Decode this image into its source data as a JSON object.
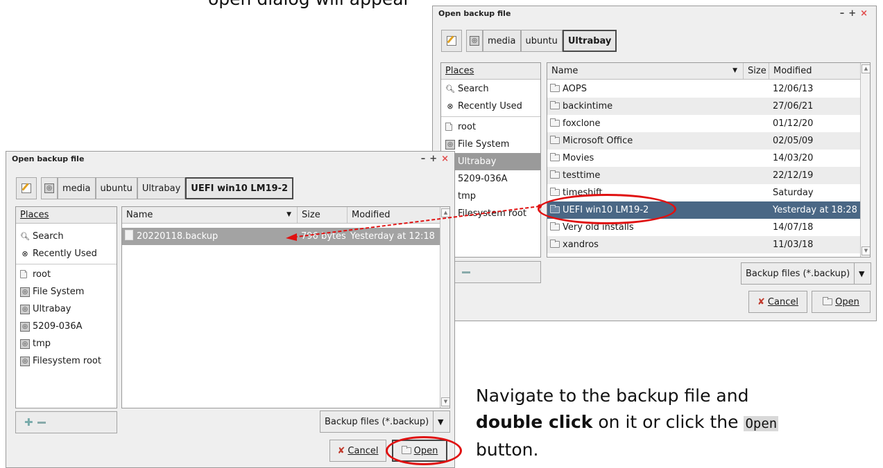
{
  "top_caption": "open dialog will appear",
  "dialog_back": {
    "title": "Open backup file",
    "controls": [
      "–",
      "+",
      "×"
    ],
    "path": [
      "media",
      "ubuntu",
      "Ultrabay"
    ],
    "places_header": "Places",
    "places": [
      {
        "label": "Search",
        "icon": "search-icon"
      },
      {
        "label": "Recently Used",
        "icon": "recent-icon"
      },
      {
        "label": "root",
        "icon": "folder-icon"
      },
      {
        "label": "File System",
        "icon": "drive-icon"
      },
      {
        "label": "Ultrabay",
        "icon": "drive-icon"
      },
      {
        "label": "5209-036A",
        "icon": "drive-icon"
      },
      {
        "label": "tmp",
        "icon": "drive-icon"
      },
      {
        "label": "Filesystem root",
        "icon": "drive-icon"
      }
    ],
    "columns": {
      "name": "Name",
      "size": "Size",
      "modified": "Modified"
    },
    "files": [
      {
        "name": "AOPS",
        "modified": "12/06/13"
      },
      {
        "name": "backintime",
        "modified": "27/06/21"
      },
      {
        "name": "foxclone",
        "modified": "01/12/20"
      },
      {
        "name": "Microsoft Office",
        "modified": "02/05/09"
      },
      {
        "name": "Movies",
        "modified": "14/03/20"
      },
      {
        "name": "testtime",
        "modified": "22/12/19"
      },
      {
        "name": "timeshift",
        "modified": "Saturday"
      },
      {
        "name": "UEFI win10 LM19-2",
        "modified": "Yesterday at 18:28"
      },
      {
        "name": "Very old installs",
        "modified": "14/07/18"
      },
      {
        "name": "xandros",
        "modified": "11/03/18"
      }
    ],
    "filter": "Backup files (*.backup)",
    "cancel": "Cancel",
    "open": "Open"
  },
  "dialog_front": {
    "title": "Open backup file",
    "controls": [
      "–",
      "+",
      "×"
    ],
    "path": [
      "media",
      "ubuntu",
      "Ultrabay",
      "UEFI win10 LM19-2"
    ],
    "places_header": "Places",
    "places": [
      {
        "label": "Search",
        "icon": "search-icon"
      },
      {
        "label": "Recently Used",
        "icon": "recent-icon"
      },
      {
        "label": "root",
        "icon": "folder-icon"
      },
      {
        "label": "File System",
        "icon": "drive-icon"
      },
      {
        "label": "Ultrabay",
        "icon": "drive-icon"
      },
      {
        "label": "5209-036A",
        "icon": "drive-icon"
      },
      {
        "label": "tmp",
        "icon": "drive-icon"
      },
      {
        "label": "Filesystem root",
        "icon": "drive-icon"
      }
    ],
    "columns": {
      "name": "Name",
      "size": "Size",
      "modified": "Modified"
    },
    "files": [
      {
        "name": "20220118.backup",
        "size": "796 bytes",
        "modified": "Yesterday at 12:18"
      }
    ],
    "filter": "Backup files (*.backup)",
    "cancel": "Cancel",
    "open": "Open"
  },
  "caption": {
    "line1": "Navigate to the backup file and",
    "bold": "double click",
    "line2": " on it or click the ",
    "kbd": "Open",
    "line3": "button."
  }
}
